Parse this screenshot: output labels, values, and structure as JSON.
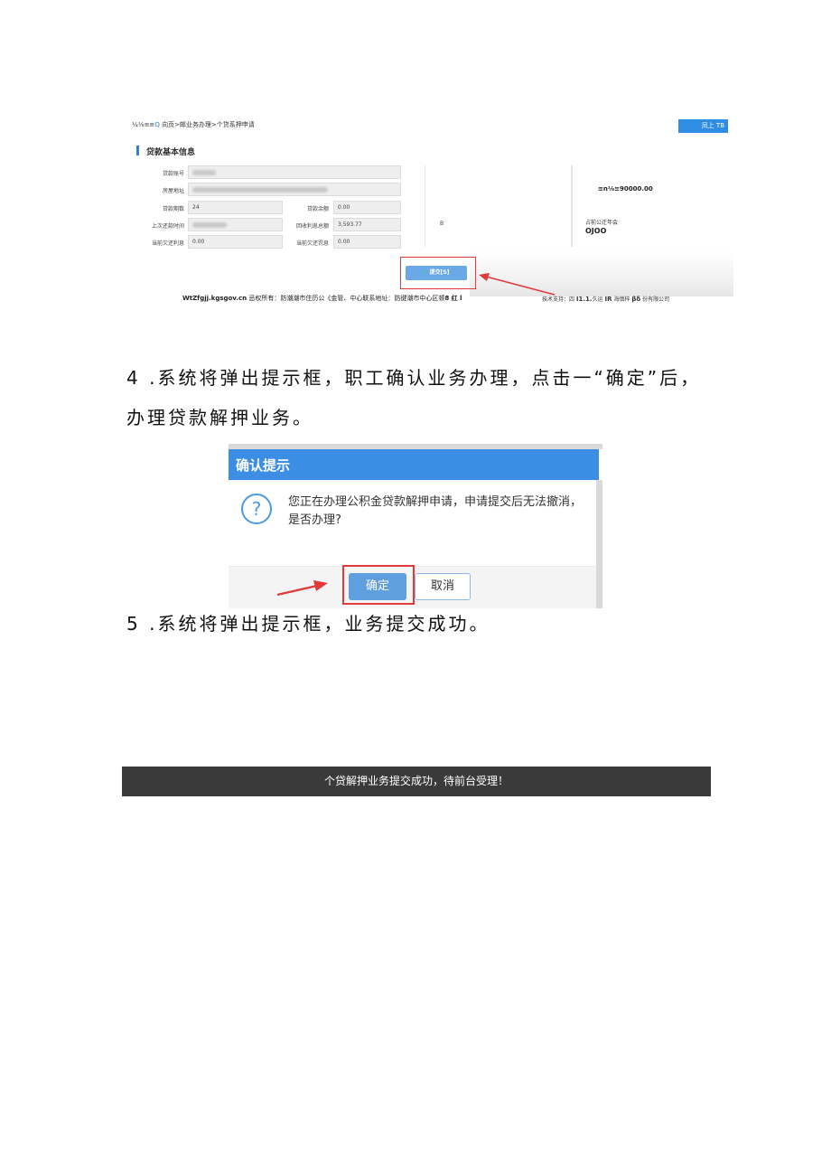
{
  "shot1": {
    "breadcrumb_prefix": "¼⅛≡≡",
    "breadcrumb_icon": "Q",
    "breadcrumb_rest": "向页>邮业务办理>个贷系押申请",
    "top_right_button": "凤上 TB",
    "section_title": "贷款基本信息",
    "fields": {
      "loan_account_label": "贷款账号",
      "house_address_label": "房屋地址",
      "loan_periods_label": "贷款期数",
      "loan_periods_value": "24",
      "loan_balance_label": "贷款余额",
      "loan_balance_value": "0.00",
      "last_repay_time_label": "上次还款时间",
      "recovered_interest_label": "回收利息总额",
      "recovered_interest_value": "3,593.77",
      "due_interest_label": "当前欠还利息",
      "due_interest_value": "0.00",
      "due_penalty_label": "当前欠还罚息",
      "due_penalty_value": "0.00"
    },
    "side_amount": "≡n⅛≡90000.00",
    "side_label": "占前公迁年会",
    "side_ojoo": "OJOO",
    "side_mark": "В",
    "submit_label": "提交[S]",
    "submit_icon": "check-icon",
    "footer_left_bold": "WtZfgjj.kgsgov.cn",
    "footer_left_rest": " 忌权所有：防潮潮市住历公《金管、中心联系地址：防键潮市中心区顿",
    "footer_left_tail": "8 红 l",
    "footer_right_prefix": "技术支持：四 ",
    "footer_right_b1": "I1.1.",
    "footer_right_mid": "久运 ",
    "footer_right_b2": "IR",
    "footer_right_mid2": " 海慎梓 ",
    "footer_right_b3": "βδ",
    "footer_right_suffix": " 份有限公司"
  },
  "step4": "4 .系统将弹出提示框，职工确认业务办理，点击一“确定”后，办理贷款解押业务。",
  "dialog": {
    "title": "确认提示",
    "icon": "question-icon",
    "message": "您正在办理公积金贷款解押申请，申请提交后无法撤消，是否办理?",
    "ok_label": "确定",
    "cancel_label": "取消"
  },
  "step5": "5 .系统将弹出提示框，业务提交成功。",
  "toast_message": "个贷解押业务提交成功，待前台受理！",
  "colors": {
    "accent_blue": "#3b8ee3",
    "highlight_red": "#e03a3a",
    "toast_bg": "#3a3a3a"
  }
}
